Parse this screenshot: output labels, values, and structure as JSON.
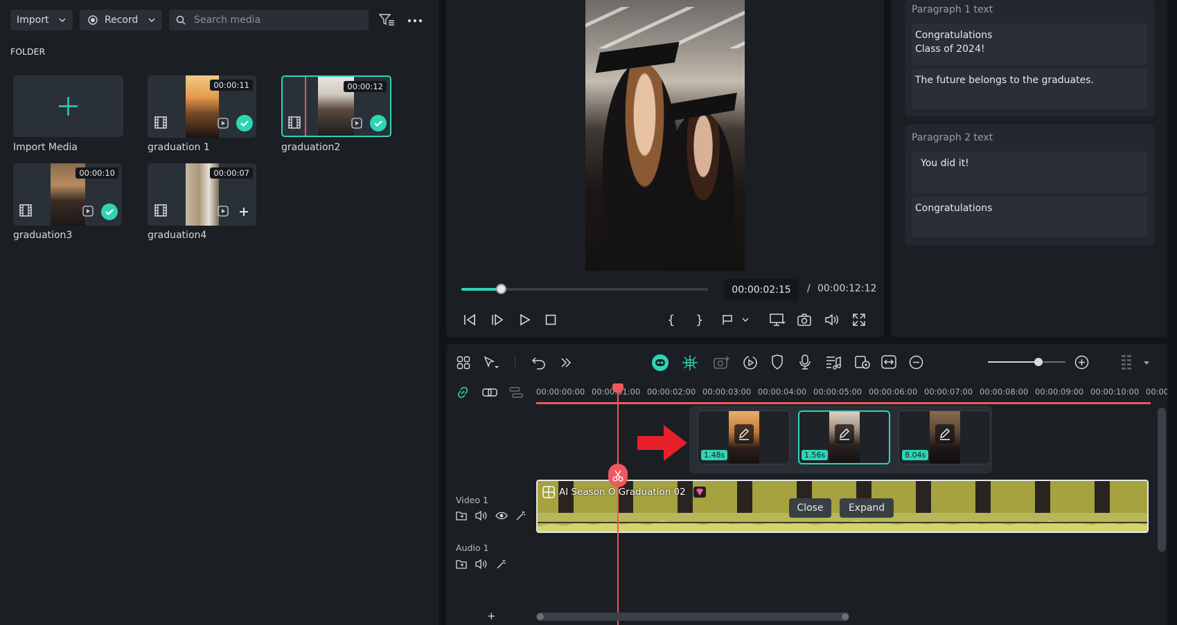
{
  "media_panel": {
    "import_label": "Import",
    "record_label": "Record",
    "search_placeholder": "Search media",
    "folder_label": "FOLDER",
    "items": [
      {
        "label": "Import Media"
      },
      {
        "label": "graduation 1",
        "duration": "00:00:11"
      },
      {
        "label": "graduation2",
        "duration": "00:00:12"
      },
      {
        "label": "graduation3",
        "duration": "00:00:10"
      },
      {
        "label": "graduation4",
        "duration": "00:00:07"
      }
    ]
  },
  "player": {
    "current_time": "00:00:02:15",
    "separator": "/",
    "total_time": "00:00:12:12",
    "progress": 0.16
  },
  "properties": {
    "groups": [
      {
        "label": "Paragraph 1 text",
        "fields": [
          "Congratulations\nClass of 2024!",
          "The future belongs to the graduates."
        ]
      },
      {
        "label": "Paragraph 2 text",
        "fields": [
          "You did it!",
          "Congratulations"
        ]
      }
    ]
  },
  "timeline": {
    "ruler": [
      "00:00:00:00",
      "00:00:01:00",
      "00:00:02:00",
      "00:00:03:00",
      "00:00:04:00",
      "00:00:05:00",
      "00:00:06:00",
      "00:00:07:00",
      "00:00:08:00",
      "00:00:09:00",
      "00:00:10:00",
      "00:00:1"
    ],
    "popup": {
      "clips": [
        {
          "duration": "1.48s"
        },
        {
          "duration": "1.56s"
        },
        {
          "duration": "8.04s"
        }
      ],
      "close_label": "Close",
      "expand_label": "Expand"
    },
    "tracks": {
      "video": "Video 1",
      "audio": "Audio 1"
    },
    "clip_title": "AI Season O  Graduation 02",
    "add_label": "+",
    "zoom_level": 0.65
  },
  "colors": {
    "accent": "#2fd4b5",
    "playhead": "#f0585f",
    "clip": "#9c9a3c",
    "arrow": "#e8202a"
  }
}
